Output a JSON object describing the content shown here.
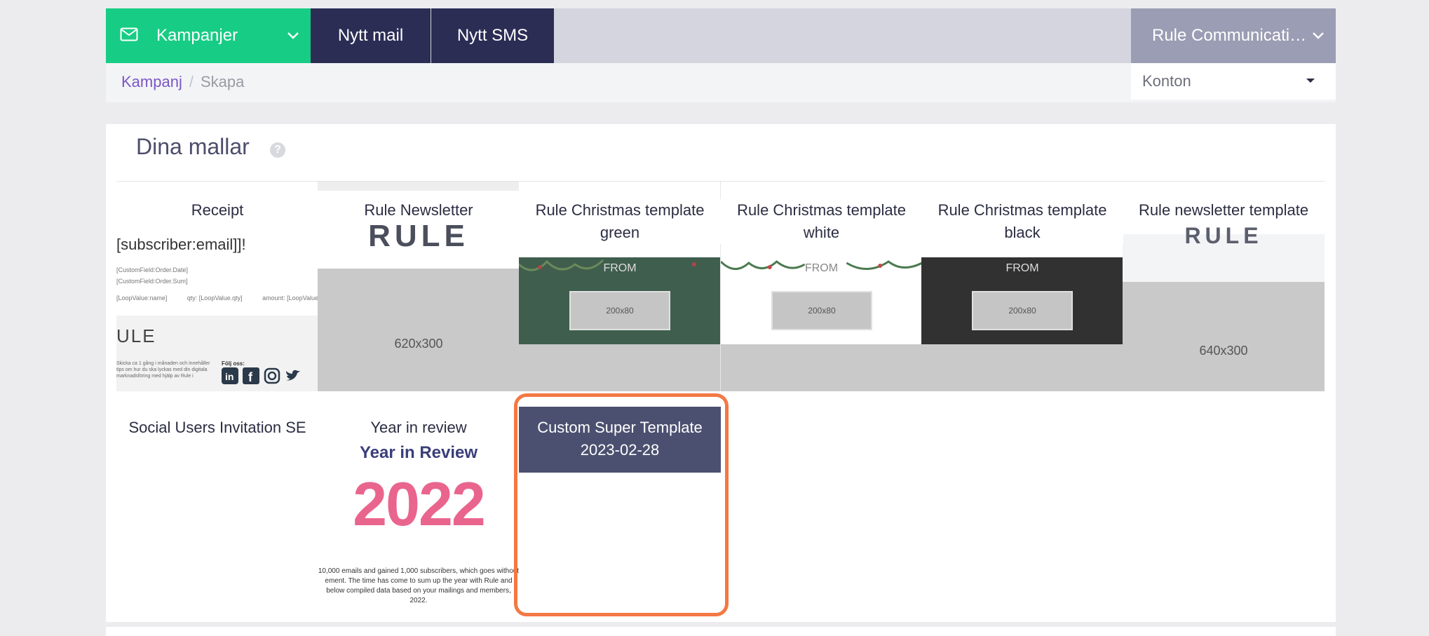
{
  "topnav": {
    "campaigns_label": "Kampanjer",
    "new_mail_label": "Nytt mail",
    "new_sms_label": "Nytt SMS",
    "account_label": "Rule Communicati…"
  },
  "breadcrumb": {
    "root": "Kampanj",
    "separator": "/",
    "current": "Skapa"
  },
  "accounts_select": {
    "value": "Konton"
  },
  "templates_section": {
    "title": "Dina mallar",
    "help_glyph": "?",
    "templates": [
      {
        "name": "Receipt"
      },
      {
        "name": "Rule Newsletter",
        "preview_text": "620x300",
        "logo": "RULE"
      },
      {
        "name": "Rule Christmas template green",
        "from_text": "FROM",
        "box_text": "200x80"
      },
      {
        "name": "Rule Christmas template white",
        "from_text": "FROM",
        "box_text": "200x80"
      },
      {
        "name": "Rule Christmas template black",
        "from_text": "FROM",
        "box_text": "200x80"
      },
      {
        "name": "Rule newsletter template",
        "preview_text": "640x300",
        "logo": "RULE"
      },
      {
        "name": "Social Users Invitation SE"
      },
      {
        "name": "Year in review",
        "preview_heading": "Year in Review",
        "preview_year": "2022"
      },
      {
        "name": "Custom Super Template 2023-02-28"
      }
    ]
  },
  "previews": {
    "receipt": {
      "line1": "[subscriber:email]]!",
      "line2": "[CustomField:Order.Date]",
      "line3": "[CustomField:Order.Sum]",
      "line4_a": "[LoopValue:name]",
      "line4_b": "qty: [LoopValue.qty]",
      "line4_c": "amount: [LoopValue",
      "logo": "ULE",
      "follow": "Följ oss:",
      "footer": "Skicka ca 1 gång i månaden och innehåller tips om hur du ska lyckas med din digitala marknadsföring med hjälp av Rule i"
    },
    "year_review_footer": "10,000 emails and gained 1,000 subscribers, which goes without ement. The time has come to sum up the year with Rule and below compiled data based on your mailings and members, 2022."
  },
  "colors": {
    "campaigns_bg": "#17cc84",
    "nav_bg": "#2c2d55",
    "account_bg": "#9a9db3",
    "highlight": "#f47843",
    "custom_card_bg": "#4c5070",
    "breadcrumb_link": "#7b57c6"
  }
}
